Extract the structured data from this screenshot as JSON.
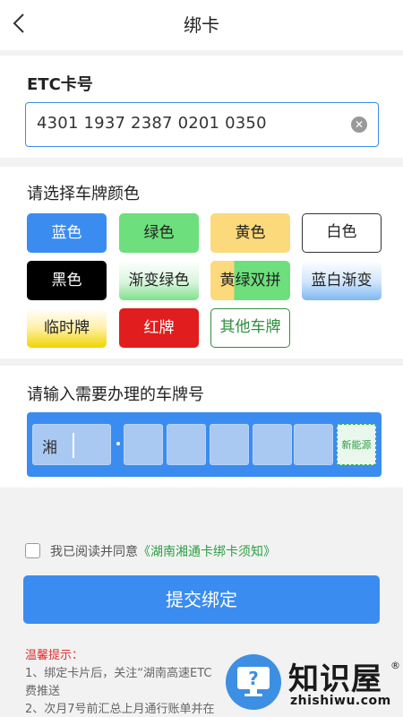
{
  "nav": {
    "title": "绑卡",
    "back_icon": "chevron-left-icon"
  },
  "etc": {
    "label": "ETC卡号",
    "value": "4301 1937 2387 0201 0350",
    "clear_icon": "clear-circle-icon"
  },
  "plate_color": {
    "label": "请选择车牌颜色",
    "options": [
      "蓝色",
      "绿色",
      "黄色",
      "白色",
      "黑色",
      "渐变绿色",
      "黄绿双拼",
      "蓝白渐变",
      "临时牌",
      "红牌",
      "其他车牌"
    ],
    "selected": "蓝色",
    "colors": {
      "blue": "#3b8cf0",
      "green": "#6ddf7c",
      "yellow": "#fcd97b",
      "black": "#000000",
      "red": "#e21d1d",
      "other_border": "#2f8f3f"
    }
  },
  "plate_number": {
    "label": "请输入需要办理的车牌号",
    "province": "湘",
    "new_energy": "新能源"
  },
  "agree": {
    "prefix": "我已阅读并同意",
    "link": "《湖南湘通卡绑卡须知》"
  },
  "submit": {
    "label": "提交绑定"
  },
  "tips": {
    "head": "温馨提示：",
    "line1": "1、绑定卡片后，关注“湖南高速ETC",
    "line1b": "费推送",
    "line2": "2、次月7号前汇总上月通行账单并在"
  },
  "watermark": {
    "main": "知识屋",
    "reg": "®",
    "url": "zhishiwu.com",
    "icon": "question-monitor-icon"
  }
}
